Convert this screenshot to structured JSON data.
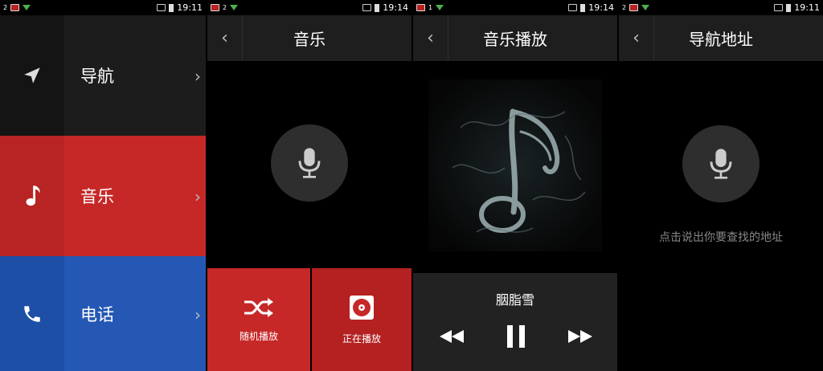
{
  "status_bars": [
    {
      "left_num": "2",
      "time": "19:11"
    },
    {
      "left_num": "2",
      "time": "19:14"
    },
    {
      "left_num": "1",
      "time": "19:14"
    },
    {
      "left_num": "2",
      "time": "19:11"
    }
  ],
  "menu": {
    "items": [
      {
        "label": "导航",
        "icon": "navigation-arrow-icon",
        "color": "#1c1c1c"
      },
      {
        "label": "音乐",
        "icon": "music-note-icon",
        "color": "#c62828"
      },
      {
        "label": "电话",
        "icon": "phone-icon",
        "color": "#2458b4"
      }
    ]
  },
  "music_screen": {
    "title": "音乐",
    "buttons": [
      {
        "label": "随机播放",
        "icon": "shuffle-icon"
      },
      {
        "label": "正在播放",
        "icon": "now-playing-disc-icon"
      }
    ]
  },
  "player_screen": {
    "title": "音乐播放",
    "song_title": "胭脂雪",
    "controls": [
      "rewind-icon",
      "pause-icon",
      "fast-forward-icon"
    ]
  },
  "nav_screen": {
    "title": "导航地址",
    "hint": "点击说出你要查找的地址"
  },
  "colors": {
    "accent_red": "#c62828",
    "accent_blue": "#2458b4",
    "header": "#1e1e1e"
  }
}
